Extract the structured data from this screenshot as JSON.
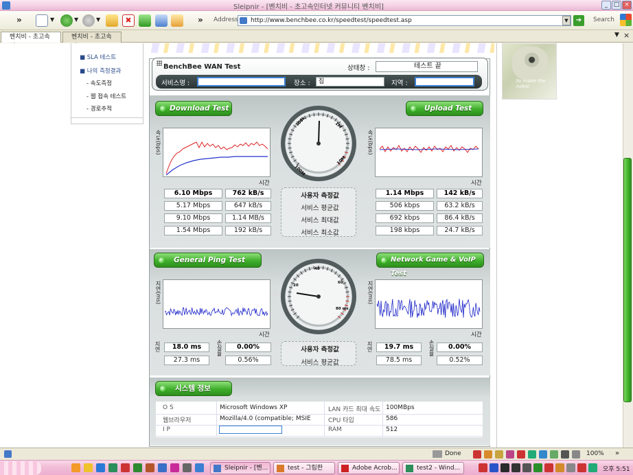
{
  "window": {
    "title": "Sleipnir - [벤치비 - 초고속인터넷 커뮤니티 벤치비]"
  },
  "toolbar": {
    "chevron": "»",
    "address_label": "Address",
    "url": "http://www.benchbee.co.kr/speedtest/speedtest.asp",
    "search_label": "Search",
    "chevron2": "»"
  },
  "tabs": [
    {
      "label": "벤치비 - 초고속인..."
    },
    {
      "label": "벤치비 - 초고속인..."
    }
  ],
  "sidebar": {
    "items": [
      "SLA 테스트",
      "나의 측정결과",
      "속도측정",
      "웹 접속 테스트",
      "경로추적"
    ]
  },
  "header": {
    "title": "BenchBee WAN Test",
    "status_label": "상태창 :",
    "status_value": "테스트 끝",
    "provider_label": "서비스명 :",
    "provider_value": "",
    "place_label": "장소 :",
    "place_value": "집",
    "region_label": "지역 :",
    "region_value": ""
  },
  "speed": {
    "download_button": "Download Test",
    "upload_button": "Upload Test",
    "ylabel": "속도(bps)",
    "xlabel": "시간",
    "row_labels": [
      "사용자 측정값",
      "서비스 평균값",
      "서비스 최대값",
      "서비스 최소값"
    ],
    "download": [
      [
        "6.10 Mbps",
        "762 kB/s"
      ],
      [
        "5.17 Mbps",
        "647 kB/s"
      ],
      [
        "9.10 Mbps",
        "1.14 MB/s"
      ],
      [
        "1.54 Mbps",
        "192 kB/s"
      ]
    ],
    "upload": [
      [
        "1.14 Mbps",
        "142 kB/s"
      ],
      [
        "506 kbps",
        "63.2 kB/s"
      ],
      [
        "692 kbps",
        "86.4 kB/s"
      ],
      [
        "198 kbps",
        "24.7 kB/s"
      ]
    ],
    "gauge_labels": [
      "100k",
      "1M",
      "10M",
      "100M"
    ]
  },
  "ping": {
    "ping_button": "General Ping Test",
    "voip_button": "Network Game & VoIP Test",
    "ylabel": "지연(ms)",
    "xlabel": "시간",
    "delay_label": "지연",
    "loss_label": "손실율",
    "row_labels": [
      "사용자 측정값",
      "서비스 평균값"
    ],
    "general": [
      [
        "18.0 ms",
        "0.00%"
      ],
      [
        "27.3 ms",
        "0.56%"
      ]
    ],
    "voip": [
      [
        "19.7 ms",
        "0.00%"
      ],
      [
        "78.5 ms",
        "0.52%"
      ]
    ],
    "gauge_labels": [
      "20",
      "40",
      "60",
      "80 ms"
    ]
  },
  "system": {
    "button": "시스템 정보",
    "rows": [
      {
        "k1": "O S",
        "v1": "Microsoft Windows XP",
        "k2": "LAN 카드 최대 속도",
        "v2": "100MBps"
      },
      {
        "k1": "웹브라우저",
        "v1": "Mozilla/4.0 (compatible; MSIE",
        "k2": "CPU 타입",
        "v2": "586"
      },
      {
        "k1": "I P",
        "v1": "",
        "k2": "RAM",
        "v2": "512"
      }
    ]
  },
  "rightimg": {
    "caption": "to make the rules!"
  },
  "statusbar": {
    "text": "Done",
    "zoom": "100%",
    "chevron": "»"
  },
  "taskbar": {
    "tasks": [
      "Sleipnir - [벤...",
      "test - 그림판",
      "Adobe Acrob...",
      "test2 - Wind..."
    ],
    "clock": "오후 5:51"
  }
}
